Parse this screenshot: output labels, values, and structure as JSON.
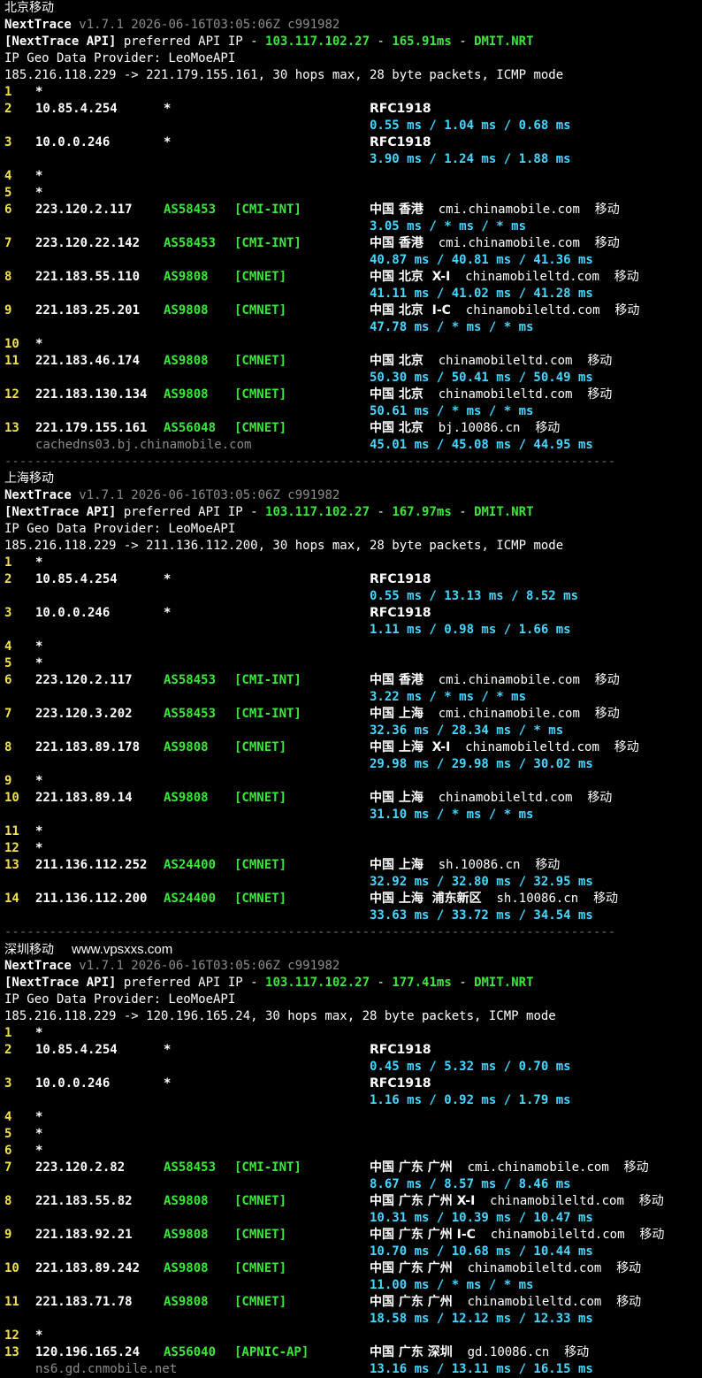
{
  "sections": [
    {
      "title": "北京移动",
      "watermark": "",
      "version_line": "v1.7.1 2026-06-16T03:05:06Z c991982",
      "app_name": "NextTrace",
      "api_prefix": "[NextTrace API]",
      "api_mid": " preferred API IP - ",
      "api_ip": "103.117.102.27",
      "api_sep": " - ",
      "api_latency": "165.91ms",
      "api_node": "DMIT.NRT",
      "geo_provider": "IP Geo Data Provider: LeoMoeAPI",
      "trace_header": "185.216.118.229 -> 221.179.155.161, 30 hops max, 28 byte packets, ICMP mode",
      "hops": [
        {
          "n": "1",
          "ip": "*",
          "asn": "",
          "tag": "",
          "geo": "",
          "host": "",
          "isp": "",
          "rtt": "",
          "rdns": ""
        },
        {
          "n": "2",
          "ip": "10.85.4.254",
          "asn": "*",
          "tag": "",
          "geo": "RFC1918",
          "host": "",
          "isp": "",
          "rtt": "0.55 ms / 1.04 ms / 0.68 ms",
          "rdns": ""
        },
        {
          "n": "3",
          "ip": "10.0.0.246",
          "asn": "*",
          "tag": "",
          "geo": "RFC1918",
          "host": "",
          "isp": "",
          "rtt": "3.90 ms / 1.24 ms / 1.88 ms",
          "rdns": ""
        },
        {
          "n": "4",
          "ip": "*",
          "asn": "",
          "tag": "",
          "geo": "",
          "host": "",
          "isp": "",
          "rtt": "",
          "rdns": ""
        },
        {
          "n": "5",
          "ip": "*",
          "asn": "",
          "tag": "",
          "geo": "",
          "host": "",
          "isp": "",
          "rtt": "",
          "rdns": ""
        },
        {
          "n": "6",
          "ip": "223.120.2.117",
          "asn": "AS58453",
          "tag": "[CMI-INT]",
          "geo": "中国 香港",
          "host": "cmi.chinamobile.com",
          "isp": "移动",
          "rtt": "3.05 ms / * ms / * ms",
          "rdns": ""
        },
        {
          "n": "7",
          "ip": "223.120.22.142",
          "asn": "AS58453",
          "tag": "[CMI-INT]",
          "geo": "中国 香港",
          "host": "cmi.chinamobile.com",
          "isp": "移动",
          "rtt": "40.87 ms / 40.81 ms / 41.36 ms",
          "rdns": ""
        },
        {
          "n": "8",
          "ip": "221.183.55.110",
          "asn": "AS9808",
          "tag": "[CMNET]",
          "geo": "中国 北京  X-I",
          "host": "chinamobileltd.com",
          "isp": "移动",
          "rtt": "41.11 ms / 41.02 ms / 41.28 ms",
          "rdns": ""
        },
        {
          "n": "9",
          "ip": "221.183.25.201",
          "asn": "AS9808",
          "tag": "[CMNET]",
          "geo": "中国 北京  I-C",
          "host": "chinamobileltd.com",
          "isp": "移动",
          "rtt": "47.78 ms / * ms / * ms",
          "rdns": ""
        },
        {
          "n": "10",
          "ip": "*",
          "asn": "",
          "tag": "",
          "geo": "",
          "host": "",
          "isp": "",
          "rtt": "",
          "rdns": ""
        },
        {
          "n": "11",
          "ip": "221.183.46.174",
          "asn": "AS9808",
          "tag": "[CMNET]",
          "geo": "中国 北京",
          "host": "chinamobileltd.com",
          "isp": "移动",
          "rtt": "50.30 ms / 50.41 ms / 50.49 ms",
          "rdns": ""
        },
        {
          "n": "12",
          "ip": "221.183.130.134",
          "asn": "AS9808",
          "tag": "[CMNET]",
          "geo": "中国 北京",
          "host": "chinamobileltd.com",
          "isp": "移动",
          "rtt": "50.61 ms / * ms / * ms",
          "rdns": ""
        },
        {
          "n": "13",
          "ip": "221.179.155.161",
          "asn": "AS56048",
          "tag": "[CMNET]",
          "geo": "中国 北京",
          "host": "bj.10086.cn",
          "isp": "移动",
          "rtt": "45.01 ms / 45.08 ms / 44.95 ms",
          "rdns": "cachedns03.bj.chinamobile.com"
        }
      ]
    },
    {
      "title": "上海移动",
      "watermark": "",
      "version_line": "v1.7.1 2026-06-16T03:05:06Z c991982",
      "app_name": "NextTrace",
      "api_prefix": "[NextTrace API]",
      "api_mid": " preferred API IP - ",
      "api_ip": "103.117.102.27",
      "api_sep": " - ",
      "api_latency": "167.97ms",
      "api_node": "DMIT.NRT",
      "geo_provider": "IP Geo Data Provider: LeoMoeAPI",
      "trace_header": "185.216.118.229 -> 211.136.112.200, 30 hops max, 28 byte packets, ICMP mode",
      "hops": [
        {
          "n": "1",
          "ip": "*",
          "asn": "",
          "tag": "",
          "geo": "",
          "host": "",
          "isp": "",
          "rtt": "",
          "rdns": ""
        },
        {
          "n": "2",
          "ip": "10.85.4.254",
          "asn": "*",
          "tag": "",
          "geo": "RFC1918",
          "host": "",
          "isp": "",
          "rtt": "0.55 ms / 13.13 ms / 8.52 ms",
          "rdns": ""
        },
        {
          "n": "3",
          "ip": "10.0.0.246",
          "asn": "*",
          "tag": "",
          "geo": "RFC1918",
          "host": "",
          "isp": "",
          "rtt": "1.11 ms / 0.98 ms / 1.66 ms",
          "rdns": ""
        },
        {
          "n": "4",
          "ip": "*",
          "asn": "",
          "tag": "",
          "geo": "",
          "host": "",
          "isp": "",
          "rtt": "",
          "rdns": ""
        },
        {
          "n": "5",
          "ip": "*",
          "asn": "",
          "tag": "",
          "geo": "",
          "host": "",
          "isp": "",
          "rtt": "",
          "rdns": ""
        },
        {
          "n": "6",
          "ip": "223.120.2.117",
          "asn": "AS58453",
          "tag": "[CMI-INT]",
          "geo": "中国 香港",
          "host": "cmi.chinamobile.com",
          "isp": "移动",
          "rtt": "3.22 ms / * ms / * ms",
          "rdns": ""
        },
        {
          "n": "7",
          "ip": "223.120.3.202",
          "asn": "AS58453",
          "tag": "[CMI-INT]",
          "geo": "中国 上海",
          "host": "cmi.chinamobile.com",
          "isp": "移动",
          "rtt": "32.36 ms / 28.34 ms / * ms",
          "rdns": ""
        },
        {
          "n": "8",
          "ip": "221.183.89.178",
          "asn": "AS9808",
          "tag": "[CMNET]",
          "geo": "中国 上海  X-I",
          "host": "chinamobileltd.com",
          "isp": "移动",
          "rtt": "29.98 ms / 29.98 ms / 30.02 ms",
          "rdns": ""
        },
        {
          "n": "9",
          "ip": "*",
          "asn": "",
          "tag": "",
          "geo": "",
          "host": "",
          "isp": "",
          "rtt": "",
          "rdns": ""
        },
        {
          "n": "10",
          "ip": "221.183.89.14",
          "asn": "AS9808",
          "tag": "[CMNET]",
          "geo": "中国 上海",
          "host": "chinamobileltd.com",
          "isp": "移动",
          "rtt": "31.10 ms / * ms / * ms",
          "rdns": ""
        },
        {
          "n": "11",
          "ip": "*",
          "asn": "",
          "tag": "",
          "geo": "",
          "host": "",
          "isp": "",
          "rtt": "",
          "rdns": ""
        },
        {
          "n": "12",
          "ip": "*",
          "asn": "",
          "tag": "",
          "geo": "",
          "host": "",
          "isp": "",
          "rtt": "",
          "rdns": ""
        },
        {
          "n": "13",
          "ip": "211.136.112.252",
          "asn": "AS24400",
          "tag": "[CMNET]",
          "geo": "中国 上海",
          "host": "sh.10086.cn",
          "isp": "移动",
          "rtt": "32.92 ms / 32.80 ms / 32.95 ms",
          "rdns": ""
        },
        {
          "n": "14",
          "ip": "211.136.112.200",
          "asn": "AS24400",
          "tag": "[CMNET]",
          "geo": "中国 上海  浦东新区",
          "host": "sh.10086.cn",
          "isp": "移动",
          "rtt": "33.63 ms / 33.72 ms / 34.54 ms",
          "rdns": ""
        }
      ]
    },
    {
      "title": "深圳移动",
      "watermark": "www.vpsxxs.com",
      "version_line": "v1.7.1 2026-06-16T03:05:06Z c991982",
      "app_name": "NextTrace",
      "api_prefix": "[NextTrace API]",
      "api_mid": " preferred API IP - ",
      "api_ip": "103.117.102.27",
      "api_sep": " - ",
      "api_latency": "177.41ms",
      "api_node": "DMIT.NRT",
      "geo_provider": "IP Geo Data Provider: LeoMoeAPI",
      "trace_header": "185.216.118.229 -> 120.196.165.24, 30 hops max, 28 byte packets, ICMP mode",
      "hops": [
        {
          "n": "1",
          "ip": "*",
          "asn": "",
          "tag": "",
          "geo": "",
          "host": "",
          "isp": "",
          "rtt": "",
          "rdns": ""
        },
        {
          "n": "2",
          "ip": "10.85.4.254",
          "asn": "*",
          "tag": "",
          "geo": "RFC1918",
          "host": "",
          "isp": "",
          "rtt": "0.45 ms / 5.32 ms / 0.70 ms",
          "rdns": ""
        },
        {
          "n": "3",
          "ip": "10.0.0.246",
          "asn": "*",
          "tag": "",
          "geo": "RFC1918",
          "host": "",
          "isp": "",
          "rtt": "1.16 ms / 0.92 ms / 1.79 ms",
          "rdns": ""
        },
        {
          "n": "4",
          "ip": "*",
          "asn": "",
          "tag": "",
          "geo": "",
          "host": "",
          "isp": "",
          "rtt": "",
          "rdns": ""
        },
        {
          "n": "5",
          "ip": "*",
          "asn": "",
          "tag": "",
          "geo": "",
          "host": "",
          "isp": "",
          "rtt": "",
          "rdns": ""
        },
        {
          "n": "6",
          "ip": "*",
          "asn": "",
          "tag": "",
          "geo": "",
          "host": "",
          "isp": "",
          "rtt": "",
          "rdns": ""
        },
        {
          "n": "7",
          "ip": "223.120.2.82",
          "asn": "AS58453",
          "tag": "[CMI-INT]",
          "geo": "中国 广东 广州",
          "host": "cmi.chinamobile.com",
          "isp": "移动",
          "rtt": "8.67 ms / 8.57 ms / 8.46 ms",
          "rdns": ""
        },
        {
          "n": "8",
          "ip": "221.183.55.82",
          "asn": "AS9808",
          "tag": "[CMNET]",
          "geo": "中国 广东 广州 X-I",
          "host": "chinamobileltd.com",
          "isp": "移动",
          "rtt": "10.31 ms / 10.39 ms / 10.47 ms",
          "rdns": ""
        },
        {
          "n": "9",
          "ip": "221.183.92.21",
          "asn": "AS9808",
          "tag": "[CMNET]",
          "geo": "中国 广东 广州 I-C",
          "host": "chinamobileltd.com",
          "isp": "移动",
          "rtt": "10.70 ms / 10.68 ms / 10.44 ms",
          "rdns": ""
        },
        {
          "n": "10",
          "ip": "221.183.89.242",
          "asn": "AS9808",
          "tag": "[CMNET]",
          "geo": "中国 广东 广州",
          "host": "chinamobileltd.com",
          "isp": "移动",
          "rtt": "11.00 ms / * ms / * ms",
          "rdns": ""
        },
        {
          "n": "11",
          "ip": "221.183.71.78",
          "asn": "AS9808",
          "tag": "[CMNET]",
          "geo": "中国 广东 广州",
          "host": "chinamobileltd.com",
          "isp": "移动",
          "rtt": "18.58 ms / 12.12 ms / 12.33 ms",
          "rdns": ""
        },
        {
          "n": "12",
          "ip": "*",
          "asn": "",
          "tag": "",
          "geo": "",
          "host": "",
          "isp": "",
          "rtt": "",
          "rdns": ""
        },
        {
          "n": "13",
          "ip": "120.196.165.24",
          "asn": "AS56040",
          "tag": "[APNIC-AP]",
          "geo": "中国 广东 深圳",
          "host": "gd.10086.cn",
          "isp": "移动",
          "rtt": "13.16 ms / 13.11 ms / 16.15 ms",
          "rdns": "ns6.gd.cnmobile.net"
        }
      ]
    }
  ],
  "separator": "----------------------------------------------------------------------------------"
}
